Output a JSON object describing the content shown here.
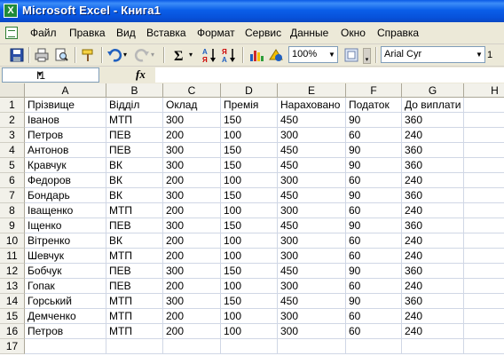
{
  "window": {
    "title": "Microsoft Excel - Книга1"
  },
  "menu": [
    "Файл",
    "Правка",
    "Вид",
    "Вставка",
    "Формат",
    "Сервис",
    "Данные",
    "Окно",
    "Справка"
  ],
  "toolbar": {
    "icons": [
      "save-icon",
      "print-icon",
      "print-preview-icon",
      "format-painter-icon",
      "undo-icon",
      "redo-icon",
      "autosum-icon",
      "sort-ascending-icon",
      "sort-descending-icon",
      "chart-wizard-icon",
      "drawing-icon"
    ],
    "zoom": "100%",
    "font_name": "Arial Cyr",
    "font_size": "1"
  },
  "formula_bar": {
    "name_box": "I1",
    "fx_label": "fx",
    "formula": ""
  },
  "sheet": {
    "columns": [
      "A",
      "B",
      "C",
      "D",
      "E",
      "F",
      "G",
      "H"
    ],
    "row_numbers": [
      "1",
      "2",
      "3",
      "4",
      "5",
      "6",
      "7",
      "8",
      "9",
      "10",
      "11",
      "12",
      "13",
      "14",
      "15",
      "16",
      "17"
    ],
    "rows": [
      [
        "Прізвище",
        "Відділ",
        "Оклад",
        "Премія",
        "Нараховано",
        "Податок",
        "До виплати"
      ],
      [
        "Іванов",
        "МТП",
        "300",
        "150",
        "450",
        "90",
        "360"
      ],
      [
        "Петров",
        "ПЕВ",
        "200",
        "100",
        "300",
        "60",
        "240"
      ],
      [
        "Антонов",
        "ПЕВ",
        "300",
        "150",
        "450",
        "90",
        "360"
      ],
      [
        "Кравчук",
        "ВК",
        "300",
        "150",
        "450",
        "90",
        "360"
      ],
      [
        "Федоров",
        "ВК",
        "200",
        "100",
        "300",
        "60",
        "240"
      ],
      [
        "Бондарь",
        "ВК",
        "300",
        "150",
        "450",
        "90",
        "360"
      ],
      [
        "Іващенко",
        "МТП",
        "200",
        "100",
        "300",
        "60",
        "240"
      ],
      [
        "Іщенко",
        "ПЕВ",
        "300",
        "150",
        "450",
        "90",
        "360"
      ],
      [
        "Вітренко",
        "ВК",
        "200",
        "100",
        "300",
        "60",
        "240"
      ],
      [
        "Шевчук",
        "МТП",
        "200",
        "100",
        "300",
        "60",
        "240"
      ],
      [
        "Бобчук",
        "ПЕВ",
        "300",
        "150",
        "450",
        "90",
        "360"
      ],
      [
        "Гопак",
        "ПЕВ",
        "200",
        "100",
        "300",
        "60",
        "240"
      ],
      [
        "Горський",
        "МТП",
        "300",
        "150",
        "450",
        "90",
        "360"
      ],
      [
        "Демченко",
        "МТП",
        "200",
        "100",
        "300",
        "60",
        "240"
      ],
      [
        "Петров",
        "МТП",
        "200",
        "100",
        "300",
        "60",
        "240"
      ]
    ]
  }
}
